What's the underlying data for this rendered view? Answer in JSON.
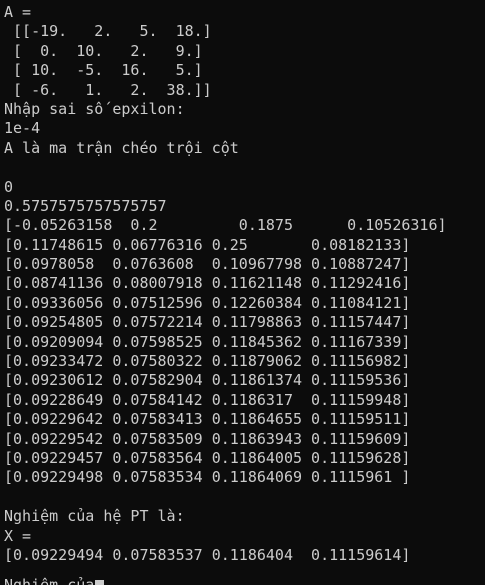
{
  "terminal": {
    "lines": [
      "A =",
      " [[-19.   2.   5.  18.]",
      " [  0.  10.   2.   9.]",
      " [ 10.  -5.  16.   5.]",
      " [ -6.   1.   2.  38.]]",
      "Nhập sai số epxilon:",
      "1e-4",
      "A là ma trận chéo trội cột",
      "",
      "0",
      "0.5757575757575757",
      "[-0.05263158  0.2         0.1875      0.10526316]",
      "[0.11748615 0.06776316 0.25       0.08182133]",
      "[0.0978058  0.0763608  0.10967798 0.10887247]",
      "[0.08741136 0.08007918 0.11621148 0.11292416]",
      "[0.09336056 0.07512596 0.12260384 0.11084121]",
      "[0.09254805 0.07572214 0.11798863 0.11157447]",
      "[0.09209094 0.07598525 0.11845362 0.11167339]",
      "[0.09233472 0.07580322 0.11879062 0.11156982]",
      "[0.09230612 0.07582904 0.11861374 0.11159536]",
      "[0.09228649 0.07584142 0.1186317  0.11159948]",
      "[0.09229642 0.07583413 0.11864655 0.11159511]",
      "[0.09229542 0.07583509 0.11863943 0.11159609]",
      "[0.09229457 0.07583564 0.11864005 0.11159628]",
      "[0.09229498 0.07583534 0.11864069 0.1115961 ]",
      "",
      "Nghiệm của hệ PT là:",
      "X =",
      "[0.09229494 0.07583537 0.1186404  0.11159614]"
    ],
    "partial_line": "Nghiệm của"
  }
}
